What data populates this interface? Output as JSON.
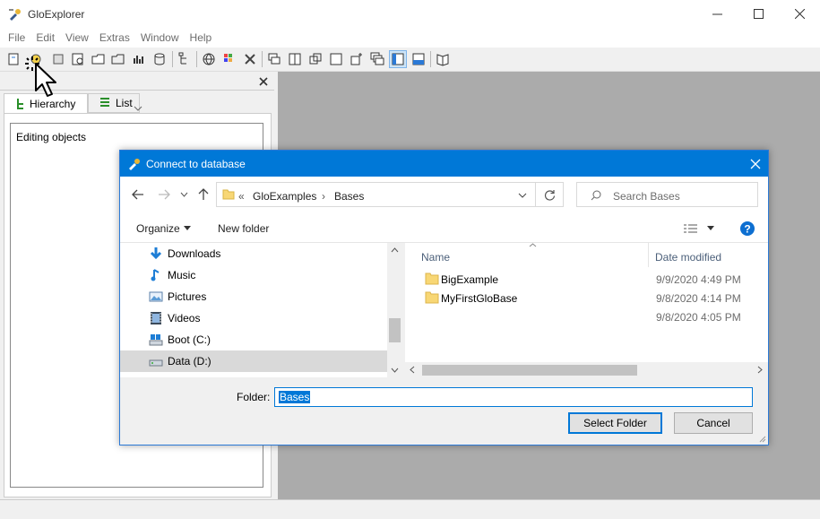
{
  "app": {
    "title": "GloExplorer",
    "menu": [
      "File",
      "Edit",
      "View",
      "Extras",
      "Window",
      "Help"
    ]
  },
  "panel": {
    "tabs": [
      {
        "label": "Hierarchy"
      },
      {
        "label": "List"
      }
    ],
    "tree_label": "Editing objects"
  },
  "dialog": {
    "title": "Connect to database",
    "breadcrumb": {
      "chevron": "«",
      "items": [
        "GloExamples",
        "Bases"
      ]
    },
    "search_placeholder": "Search Bases",
    "organize_label": "Organize",
    "new_folder_label": "New folder",
    "nav_items": [
      {
        "label": "Downloads",
        "icon": "download-icon"
      },
      {
        "label": "Music",
        "icon": "music-icon"
      },
      {
        "label": "Pictures",
        "icon": "pictures-icon"
      },
      {
        "label": "Videos",
        "icon": "videos-icon"
      },
      {
        "label": "Boot (C:)",
        "icon": "drive-icon"
      },
      {
        "label": "Data (D:)",
        "icon": "drive-icon",
        "selected": true
      }
    ],
    "columns": {
      "name": "Name",
      "date": "Date modified"
    },
    "files": [
      {
        "name": "BigExample",
        "date": "9/9/2020 4:49 PM"
      },
      {
        "name": "MyFirstGloBase",
        "date": "9/8/2020 4:14 PM"
      },
      {
        "name": "",
        "date": "9/8/2020 4:05 PM"
      }
    ],
    "folder_label": "Folder:",
    "folder_value": "Bases",
    "select_button": "Select Folder",
    "cancel_button": "Cancel"
  },
  "colors": {
    "accent": "#0078d7",
    "workspace": "#ababab",
    "folder": "#f8d775"
  }
}
